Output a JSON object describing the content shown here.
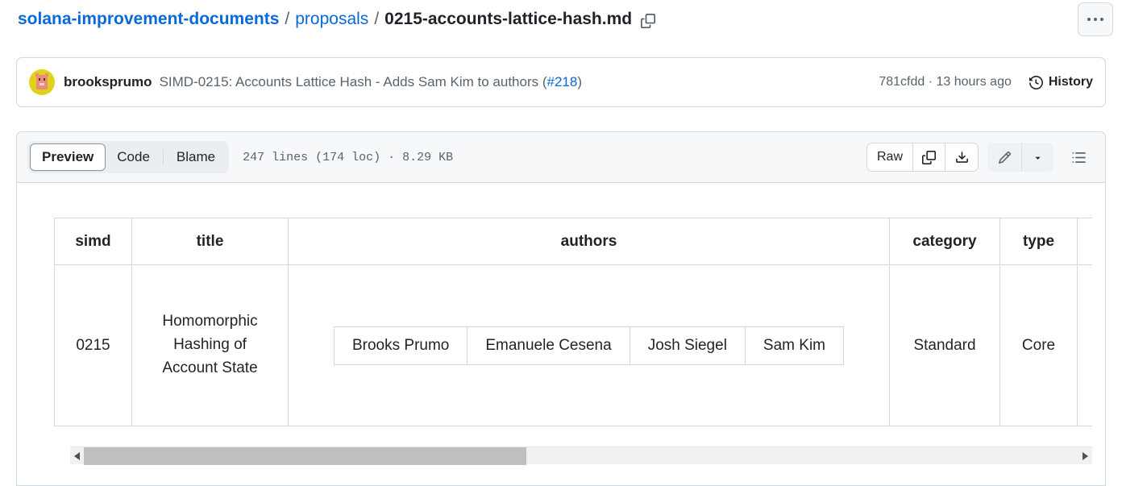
{
  "breadcrumb": {
    "repo": "solana-improvement-documents",
    "separator": "/",
    "folder": "proposals",
    "file": "0215-accounts-lattice-hash.md",
    "copy_icon": "copy-icon"
  },
  "header": {
    "more_menu_label": "•••"
  },
  "commit": {
    "author": "brooksprumo",
    "message_prefix": "SIMD-0215: Accounts Lattice Hash - Adds Sam Kim to authors (",
    "pr_number": "#218",
    "message_suffix": ")",
    "sha": "781cfdd",
    "meta": "781cfdd · 13 hours ago",
    "history_label": "History",
    "history_icon": "history-clock-icon"
  },
  "toolbar": {
    "tabs": [
      {
        "label": "Preview",
        "active": true
      },
      {
        "label": "Code",
        "active": false
      },
      {
        "label": "Blame",
        "active": false
      }
    ],
    "file_meta": "247 lines (174 loc) · 8.29 KB",
    "raw_label": "Raw",
    "copy_icon": "copy-raw-icon",
    "download_icon": "download-icon",
    "edit_icon": "pencil-edit-icon",
    "edit_caret_icon": "chevron-down-icon",
    "outline_icon": "outline-list-icon"
  },
  "table": {
    "headers": [
      "simd",
      "title",
      "authors",
      "category",
      "type",
      ""
    ],
    "row": {
      "simd": "0215",
      "title": "Homomorphic Hashing of Account State",
      "authors": [
        "Brooks Prumo",
        "Emanuele Cesena",
        "Josh Siegel",
        "Sam Kim"
      ],
      "category": "Standard",
      "type": "Core",
      "extra": ""
    }
  },
  "scrollbar": {
    "left_arrow": "scroll-left-arrow",
    "right_arrow": "scroll-right-arrow",
    "thumb_position": "0",
    "thumb_width_percent": "44.5"
  },
  "colors": {
    "link": "#0969da",
    "text": "#1f2328",
    "muted": "#59636e",
    "border": "#d1d9e0",
    "toolbar_bg": "#f6f8fa",
    "avatar_bg": "#e3d01b"
  }
}
